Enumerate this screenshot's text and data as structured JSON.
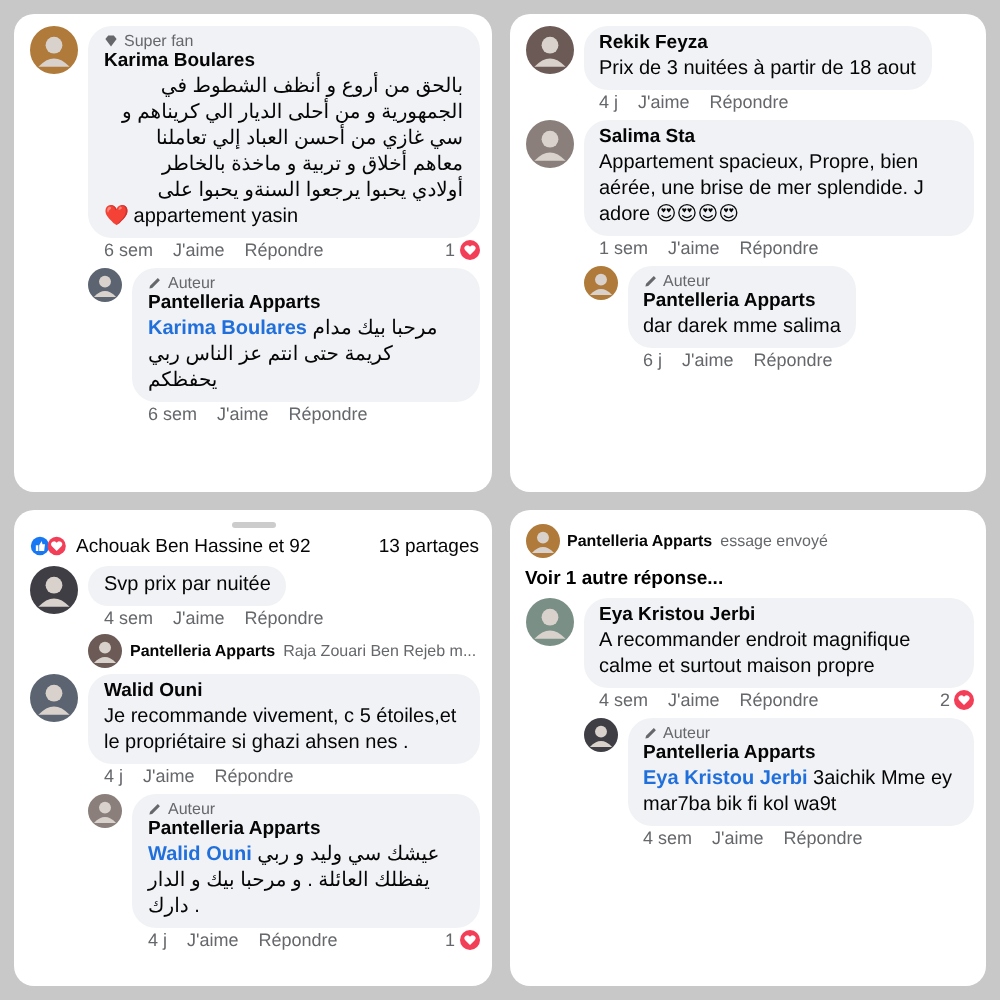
{
  "panels": [
    {
      "entries": [
        {
          "kind": "comment",
          "badge": {
            "kind": "fan",
            "text": "Super fan"
          },
          "author": "Karima Boulares",
          "paragraphs": [
            {
              "text": "بالحق من أروع و أنظف الشطوط في الجمهورية و من أحلى الديار الي كريناهم و سي غازي من أحسن العباد إلي تعاملنا معاهم أخلاق و تربية و ماخذة بالخاطر"
            },
            {
              "text": "أولادي يحبوا يرجعوا السنةو يحبوا على"
            },
            {
              "text": "❤️ appartement yasin"
            }
          ],
          "actions": {
            "time": "6 sem",
            "like": "J'aime",
            "reply": "Répondre",
            "count": "1"
          },
          "replies": [
            {
              "kind": "comment",
              "badge": {
                "kind": "author",
                "text": "Auteur"
              },
              "author": "Pantelleria Apparts",
              "paragraphs": [
                {
                  "mention": "Karima Boulares",
                  "text": "مرحبا بيك مدام كريمة حتى انتم عز الناس ربي يحفظكم"
                }
              ],
              "actions": {
                "time": "6 sem",
                "like": "J'aime",
                "reply": "Répondre"
              }
            }
          ]
        }
      ]
    },
    {
      "entries": [
        {
          "kind": "comment",
          "author": "Rekik Feyza",
          "paragraphs": [
            {
              "text": "Prix de 3 nuitées à partir de 18 aout"
            }
          ],
          "actions": {
            "time": "4 j",
            "like": "J'aime",
            "reply": "Répondre"
          }
        },
        {
          "kind": "comment",
          "author": "Salima Sta",
          "paragraphs": [
            {
              "text": "Appartement spacieux, Propre, bien aérée, une brise de mer splendide. J adore 😍😍😍😍"
            }
          ],
          "actions": {
            "time": "1 sem",
            "like": "J'aime",
            "reply": "Répondre"
          },
          "replies": [
            {
              "kind": "comment",
              "badge": {
                "kind": "author",
                "text": "Auteur"
              },
              "author": "Pantelleria Apparts",
              "paragraphs": [
                {
                  "text": "dar darek mme salima"
                }
              ],
              "actions": {
                "time": "6 j",
                "like": "J'aime",
                "reply": "Répondre"
              }
            }
          ]
        }
      ]
    },
    {
      "entries": [
        {
          "kind": "header",
          "reactions": "Achouak Ben Hassine et 92",
          "shares": "13 partages"
        },
        {
          "kind": "comment",
          "paragraphs": [
            {
              "text": "Svp prix par nuitée"
            }
          ],
          "actions": {
            "time": "4 sem",
            "like": "J'aime",
            "reply": "Répondre"
          },
          "replies": [
            {
              "kind": "preview",
              "author": "Pantelleria Apparts",
              "text": "Raja Zouari Ben Rejeb m..."
            }
          ]
        },
        {
          "kind": "comment",
          "author": "Walid Ouni",
          "paragraphs": [
            {
              "text": "Je recommande vivement, c 5 étoiles,et le propriétaire si ghazi ahsen nes ."
            }
          ],
          "actions": {
            "time": "4 j",
            "like": "J'aime",
            "reply": "Répondre"
          },
          "replies": [
            {
              "kind": "comment",
              "badge": {
                "kind": "author",
                "text": "Auteur"
              },
              "author": "Pantelleria Apparts",
              "paragraphs": [
                {
                  "mention": "Walid Ouni",
                  "text": "عيشك سي وليد و ربي يفظلك العائلة . و مرحبا بيك و الدار دارك ."
                }
              ],
              "actions": {
                "time": "4 j",
                "like": "J'aime",
                "reply": "Répondre",
                "count": "1"
              }
            }
          ]
        }
      ]
    },
    {
      "entries": [
        {
          "kind": "preview",
          "author": "Pantelleria Apparts",
          "text": "essage envoyé"
        },
        {
          "kind": "more",
          "text": "Voir 1 autre réponse..."
        },
        {
          "kind": "comment",
          "author": "Eya Kristou Jerbi",
          "paragraphs": [
            {
              "text": "A recommander endroit magnifique calme et surtout maison propre"
            }
          ],
          "actions": {
            "time": "4 sem",
            "like": "J'aime",
            "reply": "Répondre",
            "count": "2"
          },
          "replies": [
            {
              "kind": "comment",
              "badge": {
                "kind": "author",
                "text": "Auteur"
              },
              "author": "Pantelleria Apparts",
              "paragraphs": [
                {
                  "mention": "Eya Kristou Jerbi",
                  "text": "3aichik Mme ey mar7ba bik fi kol wa9t"
                }
              ],
              "actions": {
                "time": "4 sem",
                "like": "J'aime",
                "reply": "Répondre"
              }
            }
          ]
        }
      ]
    }
  ]
}
